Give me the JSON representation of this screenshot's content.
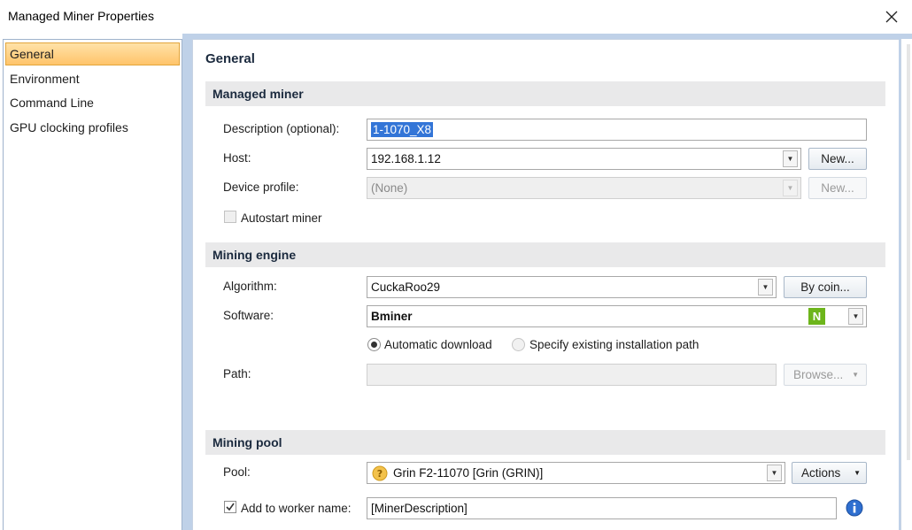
{
  "window": {
    "title": "Managed Miner Properties"
  },
  "nav": {
    "items": [
      {
        "label": "General",
        "selected": true
      },
      {
        "label": "Environment",
        "selected": false
      },
      {
        "label": "Command Line",
        "selected": false
      },
      {
        "label": "GPU clocking profiles",
        "selected": false
      }
    ]
  },
  "page": {
    "title": "General"
  },
  "managed_miner": {
    "header": "Managed miner",
    "description_label": "Description (optional):",
    "description_value": "1-1070_X8",
    "host_label": "Host:",
    "host_value": "192.168.1.12",
    "host_new_button": "New...",
    "device_profile_label": "Device profile:",
    "device_profile_value": "(None)",
    "device_profile_new_button": "New...",
    "autostart_label": "Autostart miner"
  },
  "mining_engine": {
    "header": "Mining engine",
    "algorithm_label": "Algorithm:",
    "algorithm_value": "CuckaRoo29",
    "by_coin_button": "By coin...",
    "software_label": "Software:",
    "software_value": "Bminer",
    "software_badge": "N",
    "auto_download_label": "Automatic download",
    "specify_path_label": "Specify existing installation path",
    "path_label": "Path:",
    "path_value": "",
    "browse_button": "Browse..."
  },
  "mining_pool": {
    "header": "Mining pool",
    "pool_label": "Pool:",
    "pool_value": "Grin F2-11070 [Grin (GRIN)]",
    "actions_button": "Actions",
    "add_worker_label": "Add to worker name:",
    "worker_value": "[MinerDescription]"
  },
  "colors": {
    "nav_selected": "#ffc46a",
    "frame": "#bfd1e8",
    "selection": "#3375d7",
    "nbadge": "#6db51b"
  },
  "icons": {
    "close": "close-icon",
    "coin": "coin-icon",
    "info": "info-icon",
    "dropdown": "chevron-down-icon"
  }
}
